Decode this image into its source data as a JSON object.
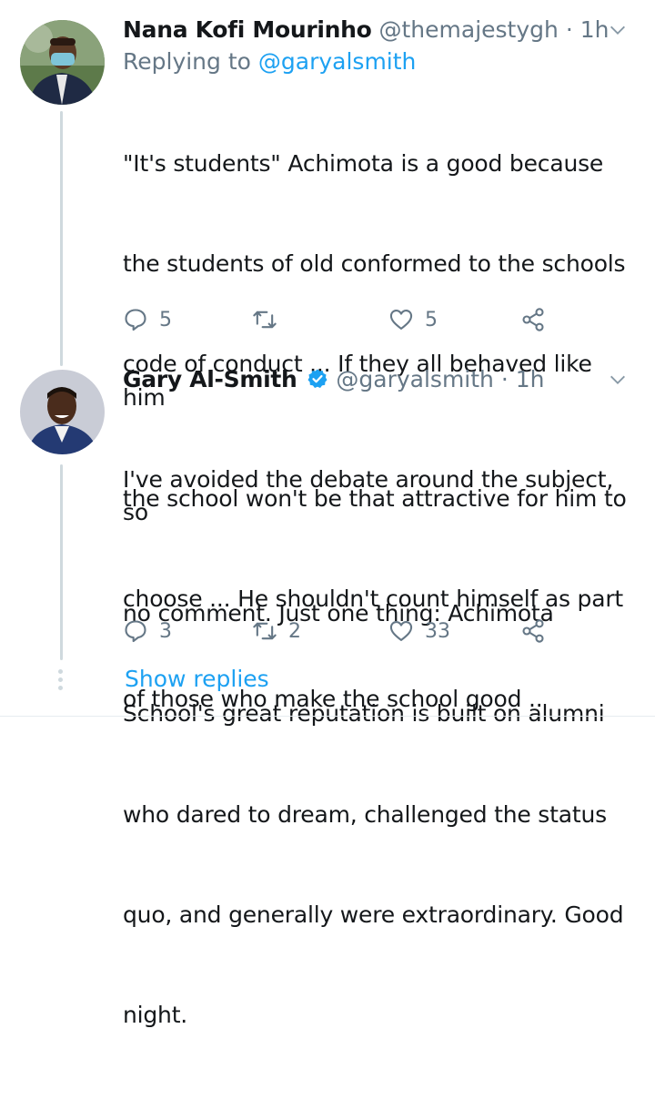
{
  "tweets": [
    {
      "name": "Nana Kofi Mourinho",
      "handle": "@themajestygh",
      "separator": "·",
      "time": "1h",
      "replying_prefix": "Replying to",
      "replying_to": "@garyalsmith",
      "lines": [
        "\"It's students\" Achimota is a good because",
        "the students of old conformed to the schools",
        "code of conduct ... If they all behaved like him",
        "the school won't be that attractive for him to",
        "choose ... He shouldn't count himself as part",
        "of those who make the school good .."
      ],
      "replies": "5",
      "retweets": "",
      "likes": "5"
    },
    {
      "name": "Gary Al-Smith",
      "handle": "@garyalsmith",
      "separator": "·",
      "time": "1h",
      "verified": true,
      "lines": [
        "I've avoided the debate around the subject, so",
        "no comment. Just one thing: Achimota",
        "School's great reputation is built on alumni",
        "who dared to dream, challenged the status",
        "quo, and generally were extraordinary. Good",
        "night."
      ],
      "replies": "3",
      "retweets": "2",
      "likes": "33"
    }
  ],
  "show_replies_label": "Show replies",
  "colors": {
    "accent": "#1da1f2",
    "secondary": "#657786",
    "thread": "#cfd9de"
  }
}
